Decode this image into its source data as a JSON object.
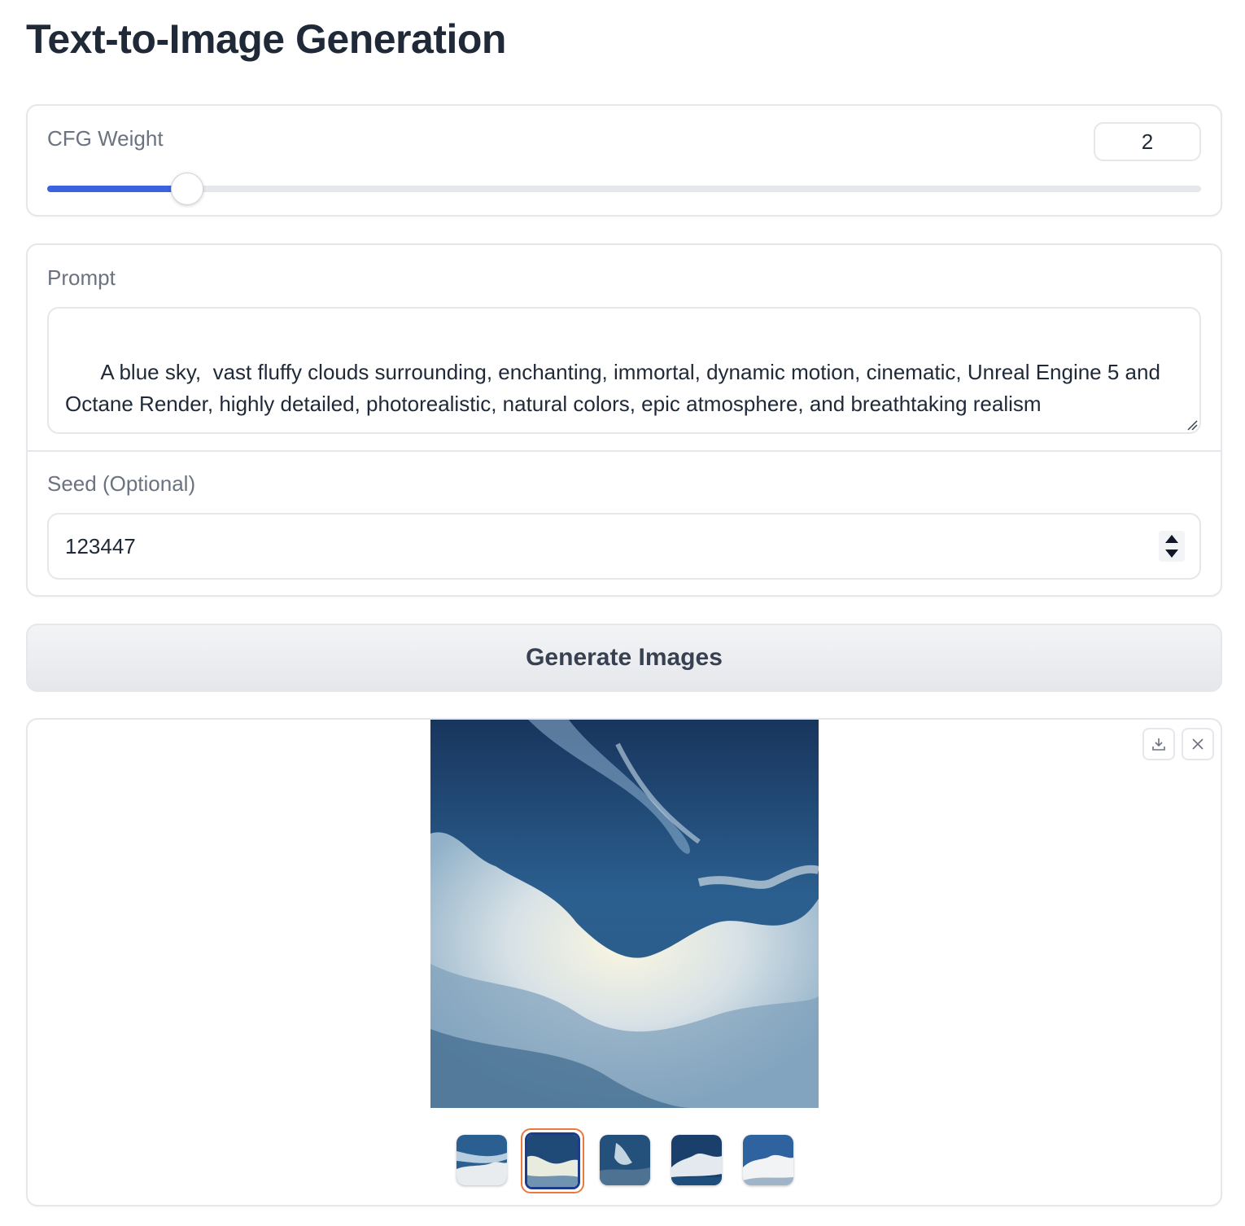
{
  "page": {
    "title": "Text-to-Image Generation"
  },
  "cfg": {
    "label": "CFG Weight",
    "value": "2",
    "fill_fraction": 0.121
  },
  "prompt": {
    "label": "Prompt",
    "value": "A blue sky,  vast fluffy clouds surrounding, enchanting, immortal, dynamic motion, cinematic, Unreal Engine 5 and Octane Render, highly detailed, photorealistic, natural colors, epic atmosphere, and breathtaking realism"
  },
  "seed": {
    "label": "Seed (Optional)",
    "value": "123447"
  },
  "generate": {
    "label": "Generate Images"
  },
  "gallery": {
    "selected_index": 1,
    "thumbnail_count": 5,
    "download_icon": "download-icon",
    "close_icon": "close-icon"
  },
  "colors": {
    "accent": "#3b63e0",
    "selected_thumb_border": "#ea7a3c",
    "sky_top": "#1a355e",
    "sky_bottom": "#3f79a8"
  }
}
